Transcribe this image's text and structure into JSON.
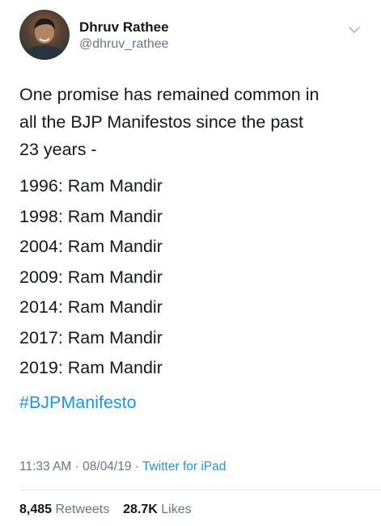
{
  "user": {
    "display_name": "Dhruv Rathee",
    "handle": "@dhruv_rathee"
  },
  "tweet": {
    "intro_lines": [
      "One promise has remained common in",
      "all the BJP Manifestos since the past",
      "23 years -"
    ],
    "year_lines": [
      "1996: Ram Mandir",
      "1998: Ram Mandir",
      "2004: Ram Mandir",
      "2009: Ram Mandir",
      "2014: Ram Mandir",
      "2017: Ram Mandir",
      "2019: Ram Mandir"
    ],
    "hashtag": "#BJPManifesto"
  },
  "meta": {
    "time": "11:33 AM",
    "separator": "·",
    "date": "08/04/19",
    "source": "Twitter for iPad"
  },
  "stats": {
    "retweets_count": "8,485",
    "retweets_label": "Retweets",
    "likes_count": "28.7K",
    "likes_label": "Likes"
  },
  "icons": {
    "avatar": "profile-photo",
    "chevron": "chevron-down-icon"
  },
  "colors": {
    "link": "#1b95e0",
    "secondary_text": "#657786",
    "primary_text": "#14171a"
  }
}
